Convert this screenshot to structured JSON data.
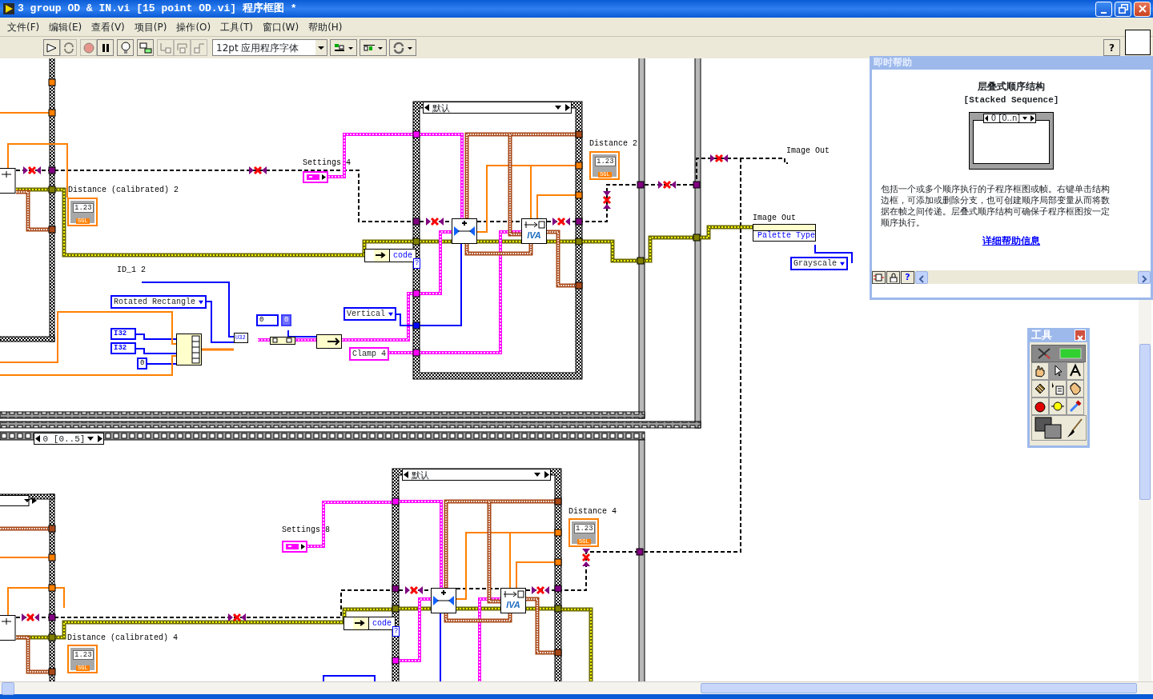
{
  "window": {
    "title": "3 group OD & IN.vi [15 point OD.vi] 程序框图 *"
  },
  "menu": [
    "文件(F)",
    "编辑(E)",
    "查看(V)",
    "项目(P)",
    "操作(O)",
    "工具(T)",
    "窗口(W)",
    "帮助(H)"
  ],
  "toolbar": {
    "buttons": [
      {
        "kind": "run",
        "disabled": false
      },
      {
        "kind": "run-continuous",
        "disabled": true
      },
      {
        "kind": "abort",
        "disabled": true
      },
      {
        "kind": "pause",
        "disabled": false
      },
      {
        "kind": "highlight",
        "disabled": false
      },
      {
        "kind": "retain",
        "disabled": false
      },
      {
        "kind": "step-into",
        "disabled": true
      },
      {
        "kind": "step-over",
        "disabled": true
      },
      {
        "kind": "step-out",
        "disabled": true
      }
    ],
    "font": "12pt 应用程序字体",
    "help": "?"
  },
  "diagram": {
    "labels": [
      "Settings 4",
      "Distance (calibrated) 2",
      "Distance 2",
      "Image Out",
      "Image Out",
      "ID_1 2",
      "Settings 8",
      "Distance 4",
      "Distance (calibrated) 4"
    ],
    "indicators": [
      {
        "value": "1.23",
        "type": "SGL"
      },
      {
        "value": "1.23",
        "type": "SGL"
      },
      {
        "value": "1.23",
        "type": "SGL"
      },
      {
        "value": "1.23",
        "type": "SGL"
      }
    ],
    "rings": [
      "Rotated Rectangle",
      "Vertical",
      "Grayscale"
    ],
    "string_constant": "Clamp 4",
    "numeric_terminals": [
      {
        "kind": "i32",
        "text": "I32"
      },
      {
        "kind": "i32",
        "text": "I32"
      },
      {
        "kind": "constant",
        "text": "0"
      },
      {
        "kind": "control",
        "text": "0"
      },
      {
        "kind": "indicator",
        "text": "0"
      }
    ],
    "conversion_node": "U32",
    "unbundles": [
      "code",
      "code"
    ],
    "property_node": {
      "item": "Palette Type"
    },
    "subvis": [
      "IVA",
      "IVA"
    ],
    "case_selectors": [
      "默认",
      "默认"
    ],
    "selector_terminals": [
      "?",
      "?"
    ],
    "sequence_selector": "0 [0..5]"
  },
  "context_help": {
    "title": "即时帮助",
    "heading": "层叠式顺序结构",
    "subheading": "[Stacked Sequence]",
    "illustration_selector": "0 [0..n]",
    "description": "包括一个或多个顺序执行的子程序框图或帧。右键单击结构边框，可添加或删除分支，也可创建顺序局部变量从而将数据在帧之间传递。层叠式顺序结构可确保子程序框图按一定顺序执行。",
    "link": "详细帮助信息",
    "help_button": "?"
  },
  "tools_palette": {
    "title": "工具",
    "tools": [
      {
        "kind": "operate",
        "selected": false
      },
      {
        "kind": "position",
        "selected": true
      },
      {
        "kind": "label",
        "selected": false
      },
      {
        "kind": "wire",
        "selected": false
      },
      {
        "kind": "menu",
        "selected": false
      },
      {
        "kind": "scroll",
        "selected": false
      },
      {
        "kind": "breakpoint",
        "selected": false
      },
      {
        "kind": "probe",
        "selected": false
      },
      {
        "kind": "copy-color",
        "selected": false
      }
    ]
  }
}
